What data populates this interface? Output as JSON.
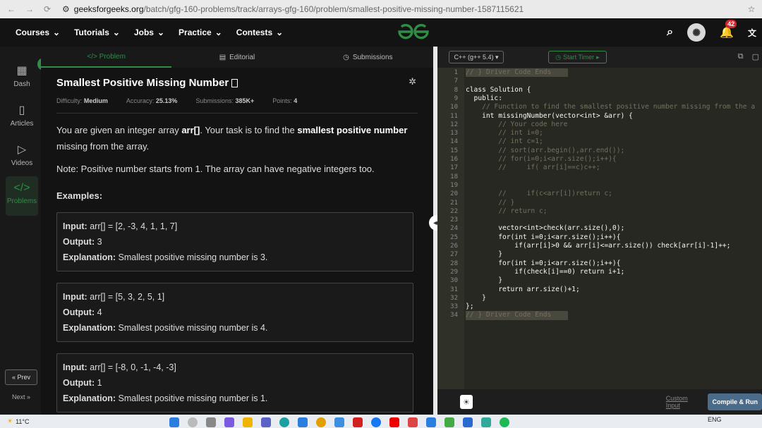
{
  "browser": {
    "url_domain": "geeksforgeeks.org",
    "url_path": "/batch/gfg-160-problems/track/arrays-gfg-160/problem/smallest-positive-missing-number-1587115621"
  },
  "topnav": {
    "items": [
      "Courses",
      "Tutorials",
      "Jobs",
      "Practice",
      "Contests"
    ],
    "notif_count": "42"
  },
  "sidebar": {
    "items": [
      "Dash",
      "Articles",
      "Videos",
      "Problems"
    ],
    "prev": "« Prev",
    "next": "Next »"
  },
  "tabs": [
    "</> Problem",
    "Editorial",
    "Submissions"
  ],
  "problem": {
    "title": "Smallest Positive Missing Number",
    "difficulty_label": "Difficulty:",
    "difficulty": "Medium",
    "accuracy_label": "Accuracy:",
    "accuracy": "25.13%",
    "submissions_label": "Submissions:",
    "submissions": "385K+",
    "points_label": "Points:",
    "points": "4",
    "desc_1": "You are given an integer array ",
    "desc_arr": "arr[]",
    "desc_2": ". Your task is to find the ",
    "desc_bold": "smallest positive number",
    "desc_3": " missing from the array.",
    "note": "Note: Positive number starts from 1. The array can have negative integers too.",
    "examples_heading": "Examples:",
    "examples": [
      {
        "input_label": "Input:",
        "input": "arr[] = [2, -3, 4, 1, 1, 7]",
        "output_label": "Output:",
        "output": "3",
        "expl_label": "Explanation:",
        "expl": "Smallest positive missing number is 3."
      },
      {
        "input_label": "Input:",
        "input": "arr[] = [5, 3, 2, 5, 1]",
        "output_label": "Output:",
        "output": "4",
        "expl_label": "Explanation:",
        "expl": "Smallest positive missing number is 4."
      },
      {
        "input_label": "Input:",
        "input": "arr[] = [-8, 0, -1, -4, -3]",
        "output_label": "Output:",
        "output": "1",
        "expl_label": "Explanation:",
        "expl": "Smallest positive missing number is 1."
      }
    ]
  },
  "editor": {
    "language": "C++ (g++ 5.4)",
    "timer": "Start Timer",
    "custom_input": "Custom Input",
    "compile_run": "Compile & Run",
    "lines": [
      {
        "n": "1",
        "t": "// } Driver Code Ends",
        "fold": true
      },
      {
        "n": "7",
        "t": ""
      },
      {
        "n": "8",
        "t": "class Solution {"
      },
      {
        "n": "9",
        "t": "  public:"
      },
      {
        "n": "10",
        "t": "    // Function to find the smallest positive number missing from the a"
      },
      {
        "n": "11",
        "t": "    int missingNumber(vector<int> &arr) {"
      },
      {
        "n": "12",
        "t": "        // Your code here"
      },
      {
        "n": "13",
        "t": "        // int i=0;"
      },
      {
        "n": "14",
        "t": "        // int c=1;"
      },
      {
        "n": "15",
        "t": "        // sort(arr.begin(),arr.end());"
      },
      {
        "n": "16",
        "t": "        // for(i=0;i<arr.size();i++){"
      },
      {
        "n": "17",
        "t": "        //     if( arr[i]==c)c++;"
      },
      {
        "n": "18",
        "t": ""
      },
      {
        "n": "19",
        "t": ""
      },
      {
        "n": "20",
        "t": "        //     if(c<arr[i])return c;"
      },
      {
        "n": "21",
        "t": "        // }"
      },
      {
        "n": "22",
        "t": "        // return c;"
      },
      {
        "n": "23",
        "t": ""
      },
      {
        "n": "24",
        "t": "        vector<int>check(arr.size(),0);"
      },
      {
        "n": "25",
        "t": "        for(int i=0;i<arr.size();i++){"
      },
      {
        "n": "26",
        "t": "            if(arr[i]>0 && arr[i]<=arr.size()) check[arr[i]-1]++;"
      },
      {
        "n": "27",
        "t": "        }"
      },
      {
        "n": "28",
        "t": "        for(int i=0;i<arr.size();i++){"
      },
      {
        "n": "29",
        "t": "            if(check[i]==0) return i+1;"
      },
      {
        "n": "30",
        "t": "        }"
      },
      {
        "n": "31",
        "t": "        return arr.size()+1;"
      },
      {
        "n": "32",
        "t": "    }"
      },
      {
        "n": "33",
        "t": "};"
      },
      {
        "n": "34",
        "t": "// } Driver Code Ends",
        "fold": true
      }
    ]
  },
  "taskbar": {
    "temp": "11°C",
    "lang": "ENG"
  }
}
